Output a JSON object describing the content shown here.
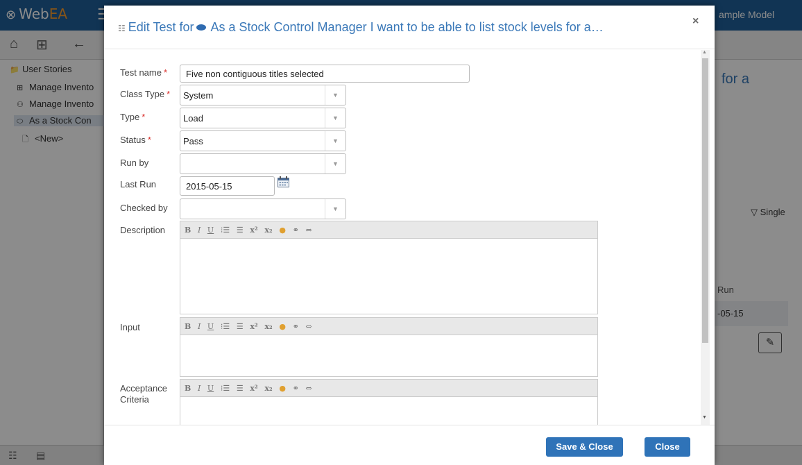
{
  "app": {
    "logo_prefix": "Web",
    "logo_suffix": "EA",
    "model_name": "ample Model",
    "bg_title": "for a",
    "bg_filter": "Single",
    "bg_run_header": "Run",
    "bg_run_value": "-05-15"
  },
  "tree": {
    "items": [
      {
        "label": "User Stories"
      },
      {
        "label": "Manage Invento"
      },
      {
        "label": "Manage Invento"
      },
      {
        "label": "As a Stock Con"
      },
      {
        "label": "<New>"
      }
    ]
  },
  "dialog": {
    "title_prefix": "Edit Test for",
    "title_text": "As a Stock Control Manager I want to be able to list stock levels for a…",
    "close_glyph": "×",
    "fields": {
      "test_name": {
        "label": "Test name",
        "value": "Five non contiguous titles selected"
      },
      "class_type": {
        "label": "Class Type",
        "value": "System"
      },
      "type": {
        "label": "Type",
        "value": "Load"
      },
      "status": {
        "label": "Status",
        "value": "Pass"
      },
      "run_by": {
        "label": "Run by",
        "value": ""
      },
      "last_run": {
        "label": "Last Run",
        "value": "2015-05-15"
      },
      "checked_by": {
        "label": "Checked by",
        "value": ""
      },
      "description": {
        "label": "Description"
      },
      "input": {
        "label": "Input"
      },
      "acceptance": {
        "label_line1": "Acceptance",
        "label_line2": "Criteria"
      }
    },
    "required_mark": "*",
    "editor_toolbar": [
      "B",
      "I",
      "U",
      "⁝☰",
      "☰",
      "x²",
      "x₂",
      "●",
      "⚭",
      "⇔"
    ],
    "buttons": {
      "save_close": "Save & Close",
      "close": "Close"
    }
  },
  "colors": {
    "header": "#1f5f99",
    "accent": "#3a78b8",
    "button": "#2f73b8",
    "required": "#d9302c"
  }
}
